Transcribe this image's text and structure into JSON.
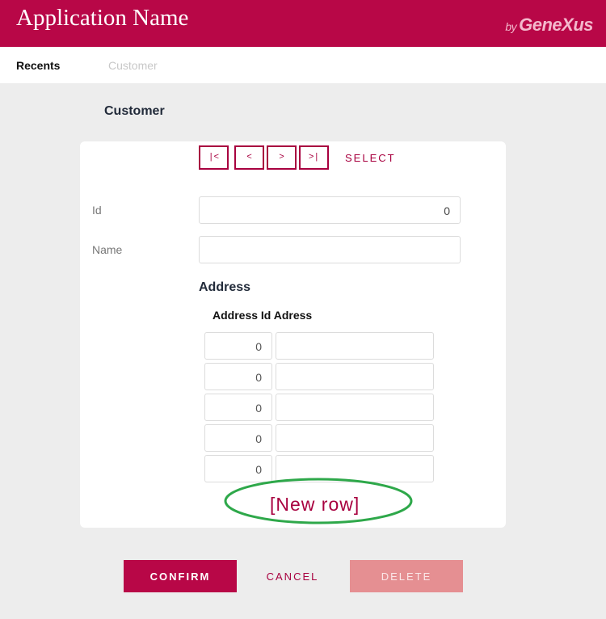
{
  "header": {
    "app_title": "Application Name",
    "brand_by": "by",
    "brand_name": "GeneXus"
  },
  "tabs": [
    {
      "label": "Recents",
      "active": true
    },
    {
      "label": "Customer",
      "active": false
    }
  ],
  "page_title": "Customer",
  "nav": {
    "first": "|<",
    "prev": "<",
    "next": ">",
    "last": ">|",
    "select": "SELECT"
  },
  "form": {
    "id": {
      "label": "Id",
      "value": "0"
    },
    "name": {
      "label": "Name",
      "value": ""
    }
  },
  "address": {
    "title": "Address",
    "columns_header": "Address Id Adress",
    "rows": [
      {
        "id": "0",
        "adress": ""
      },
      {
        "id": "0",
        "adress": ""
      },
      {
        "id": "0",
        "adress": ""
      },
      {
        "id": "0",
        "adress": ""
      },
      {
        "id": "0",
        "adress": ""
      }
    ],
    "new_row": "[New row]",
    "highlight_color": "#2ea84a"
  },
  "actions": {
    "confirm": "CONFIRM",
    "cancel": "CANCEL",
    "delete": "DELETE"
  },
  "colors": {
    "brand": "#b80747",
    "accent": "#a8003f",
    "delete_disabled": "#e58f92"
  }
}
